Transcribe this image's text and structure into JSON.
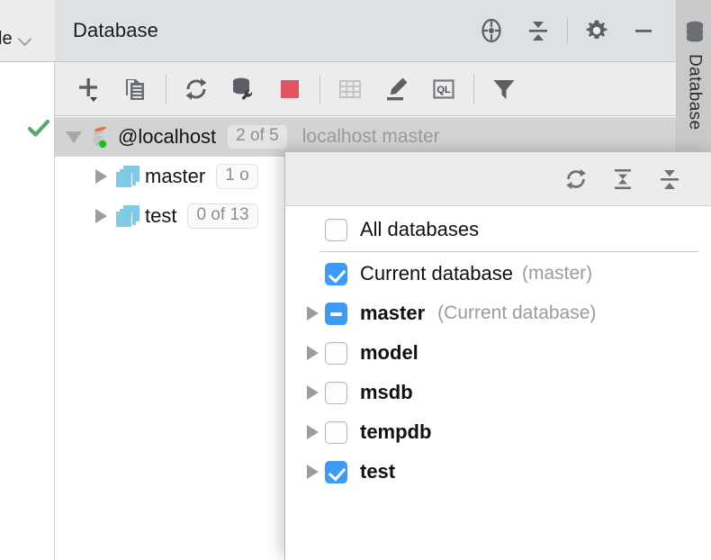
{
  "left_panel": {
    "combo_label": "le",
    "combo_icon": "chevron-down-icon",
    "status_icon": "green-check-icon"
  },
  "header": {
    "title": "Database",
    "actions": [
      {
        "name": "locate-icon",
        "label": "Scroll from Source"
      },
      {
        "name": "collapse-all-icon",
        "label": "Collapse All"
      },
      {
        "name": "gear-icon",
        "label": "Settings"
      },
      {
        "name": "minimize-icon",
        "label": "Hide"
      }
    ]
  },
  "toolbar": {
    "buttons": [
      {
        "name": "add-icon",
        "label": "New"
      },
      {
        "name": "duplicate-icon",
        "label": "Duplicate"
      },
      {
        "name": "refresh-icon",
        "label": "Refresh"
      },
      {
        "name": "database-tools-icon",
        "label": "Database Tools"
      },
      {
        "name": "stop-icon",
        "label": "Stop"
      },
      {
        "name": "table-icon",
        "label": "Jump to Console"
      },
      {
        "name": "edit-icon",
        "label": "Modify"
      },
      {
        "name": "ql-icon",
        "label": "Query Language"
      },
      {
        "name": "filter-icon",
        "label": "Filter"
      }
    ]
  },
  "tree": {
    "rows": [
      {
        "id": "localhost",
        "label": "@localhost",
        "badge": "2 of 5",
        "subtitle": "localhost master",
        "icon": "sqlserver-icon",
        "twisty": "down",
        "selected": true,
        "indent": 0
      },
      {
        "id": "master",
        "label": "master",
        "badge": "1 o",
        "subtitle": "",
        "icon": "schema-stack-icon",
        "twisty": "right",
        "selected": false,
        "indent": 1
      },
      {
        "id": "test",
        "label": "test",
        "badge": "0 of 13",
        "subtitle": "",
        "icon": "schema-stack-icon",
        "twisty": "right",
        "selected": false,
        "indent": 1
      }
    ]
  },
  "tool_strip": {
    "tab_label": "Database",
    "tab_icon": "database-icon"
  },
  "popup": {
    "toolbar_buttons": [
      {
        "name": "refresh-icon",
        "label": "Refresh"
      },
      {
        "name": "expand-all-icon",
        "label": "Expand All"
      },
      {
        "name": "collapse-all-icon",
        "label": "Collapse All"
      }
    ],
    "items": [
      {
        "id": "all-databases",
        "label": "All databases",
        "note": "",
        "state": "off",
        "twisty": false,
        "bold": false,
        "separator_after": true
      },
      {
        "id": "current-database",
        "label": "Current database",
        "note": "(master)",
        "state": "on",
        "twisty": false,
        "bold": false,
        "separator_after": false
      },
      {
        "id": "master",
        "label": "master",
        "note": "(Current database)",
        "state": "mixed",
        "twisty": true,
        "bold": true,
        "separator_after": false
      },
      {
        "id": "model",
        "label": "model",
        "note": "",
        "state": "off",
        "twisty": true,
        "bold": true,
        "separator_after": false
      },
      {
        "id": "msdb",
        "label": "msdb",
        "note": "",
        "state": "off",
        "twisty": true,
        "bold": true,
        "separator_after": false
      },
      {
        "id": "tempdb",
        "label": "tempdb",
        "note": "",
        "state": "off",
        "twisty": true,
        "bold": true,
        "separator_after": false
      },
      {
        "id": "test",
        "label": "test",
        "note": "",
        "state": "on",
        "twisty": true,
        "bold": true,
        "separator_after": false
      }
    ]
  },
  "colors": {
    "accent_blue": "#3d9af5",
    "header_bg": "#dde1e6",
    "toolbar_bg": "#ececec",
    "selection_gray": "#d3d3d3",
    "stop_red": "#e05561",
    "db_icon_blue": "#7ecbe8",
    "connected_green": "#18c218"
  }
}
